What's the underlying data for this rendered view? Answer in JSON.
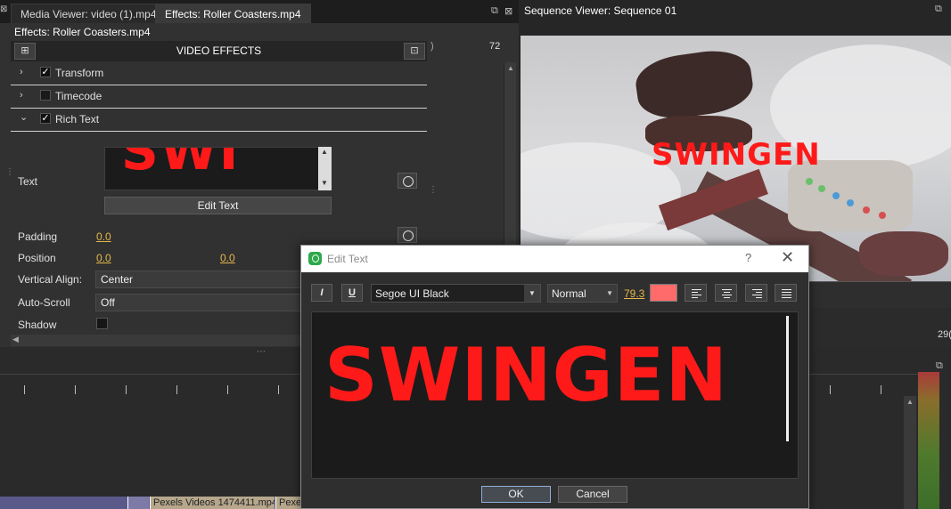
{
  "tabs": {
    "media_viewer": "Media Viewer: video (1).mp4",
    "effects": "Effects: Roller Coasters.mp4"
  },
  "effects_panel": {
    "title": "Effects: Roller Coasters.mp4",
    "header": "VIDEO EFFECTS",
    "ruler_value": "72",
    "effects": [
      {
        "label": "Transform",
        "expanded": false,
        "enabled": true
      },
      {
        "label": "Timecode",
        "expanded": false,
        "enabled": false
      },
      {
        "label": "Rich Text",
        "expanded": true,
        "enabled": true
      }
    ],
    "text_label": "Text",
    "preview_text": "SWI",
    "edit_text_button": "Edit Text",
    "padding": {
      "label": "Padding",
      "value": "0.0"
    },
    "position": {
      "label": "Position",
      "x": "0.0",
      "y": "0.0"
    },
    "vertical_align": {
      "label": "Vertical Align:",
      "value": "Center"
    },
    "auto_scroll": {
      "label": "Auto-Scroll",
      "value": "Off"
    },
    "shadow": {
      "label": "Shadow",
      "enabled": false
    }
  },
  "sequence_viewer": {
    "title": "Sequence Viewer: Sequence 01",
    "overlay_text": "SWINGEN",
    "timecode_partial": "29("
  },
  "timeline": {
    "clips": [
      "Pexels Videos 1474411.mp4",
      "Pexe"
    ]
  },
  "edit_text_dialog": {
    "title": "Edit Text",
    "help": "?",
    "close": "✕",
    "italic": "I",
    "underline": "U",
    "font": "Segoe UI Black",
    "weight": "Normal",
    "size": "79.3",
    "color": "#ff6a6a",
    "text": "SWINGEN",
    "ok": "OK",
    "cancel": "Cancel"
  },
  "colors": {
    "text_red": "#ff1a1a",
    "accent_value": "#e4b84a",
    "panel_bg": "#313131"
  }
}
